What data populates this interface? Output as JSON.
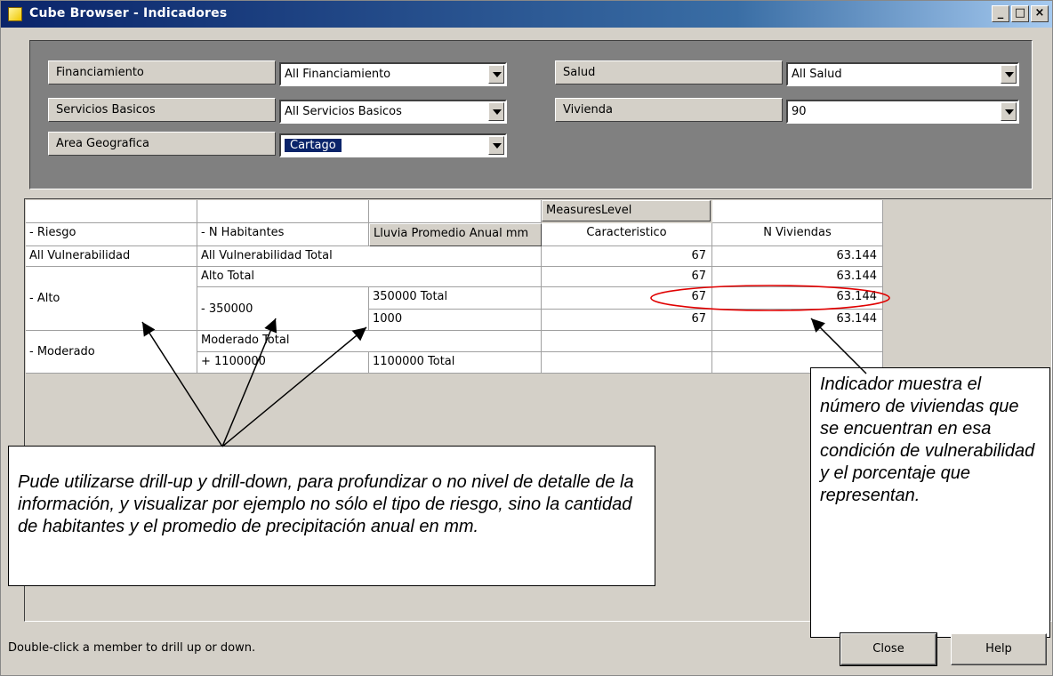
{
  "window": {
    "title": "Cube Browser - Indicadores",
    "minimize_label": "_",
    "maximize_label": "□",
    "close_label": "×"
  },
  "filters": [
    {
      "label": "Financiamiento",
      "value": "All Financiamiento"
    },
    {
      "label": "Servicios Basicos",
      "value": "All Servicios Basicos"
    },
    {
      "label": "Area Geografica",
      "value": "Cartago"
    },
    {
      "label": "Salud",
      "value": "All Salud"
    },
    {
      "label": "Vivienda",
      "value": "90"
    }
  ],
  "grid": {
    "measures_header": "MeasuresLevel",
    "dim_headers": [
      "- Riesgo",
      "- N Habitantes",
      "Lluvia Promedio Anual  mm"
    ],
    "measure_headers": [
      "Caracteristico",
      "N Viviendas"
    ],
    "rows": [
      {
        "c1": "All Vulnerabilidad",
        "c2": "All Vulnerabilidad Total",
        "c3": "",
        "caracteristico": "67",
        "viviendas": "63.144"
      },
      {
        "c1": "- Alto",
        "c2": "Alto Total",
        "c3": "",
        "caracteristico": "67",
        "viviendas": "63.144"
      },
      {
        "c1": "",
        "c2": "- 350000",
        "c3": "350000 Total",
        "caracteristico": "67",
        "viviendas": "63.144"
      },
      {
        "c1": "",
        "c2": "",
        "c3": "1000",
        "caracteristico": "67",
        "viviendas": "63.144"
      },
      {
        "c1": "- Moderado",
        "c2": "Moderado Total",
        "c3": "",
        "caracteristico": "",
        "viviendas": ""
      },
      {
        "c1": "",
        "c2": "+ 1100000",
        "c3": "1100000 Total",
        "caracteristico": "",
        "viviendas": ""
      }
    ]
  },
  "callouts": {
    "right": "Indicador muestra el número de viviendas que se encuentran en esa condición de vulnerabilidad  y el porcentaje que representan.",
    "left": "Pude utilizarse drill-up y drill-down, para profundizar o no nivel de detalle de la información, y visualizar por ejemplo no sólo el tipo de riesgo, sino la cantidad de habitantes y el promedio de precipitación anual en mm."
  },
  "status": "Double-click a member to drill up or down.",
  "buttons": {
    "close": "Close",
    "help": "Help"
  },
  "colors": {
    "titlebar": "#0a246a",
    "panel": "#808080",
    "highlight_ellipse": "#e00000"
  }
}
